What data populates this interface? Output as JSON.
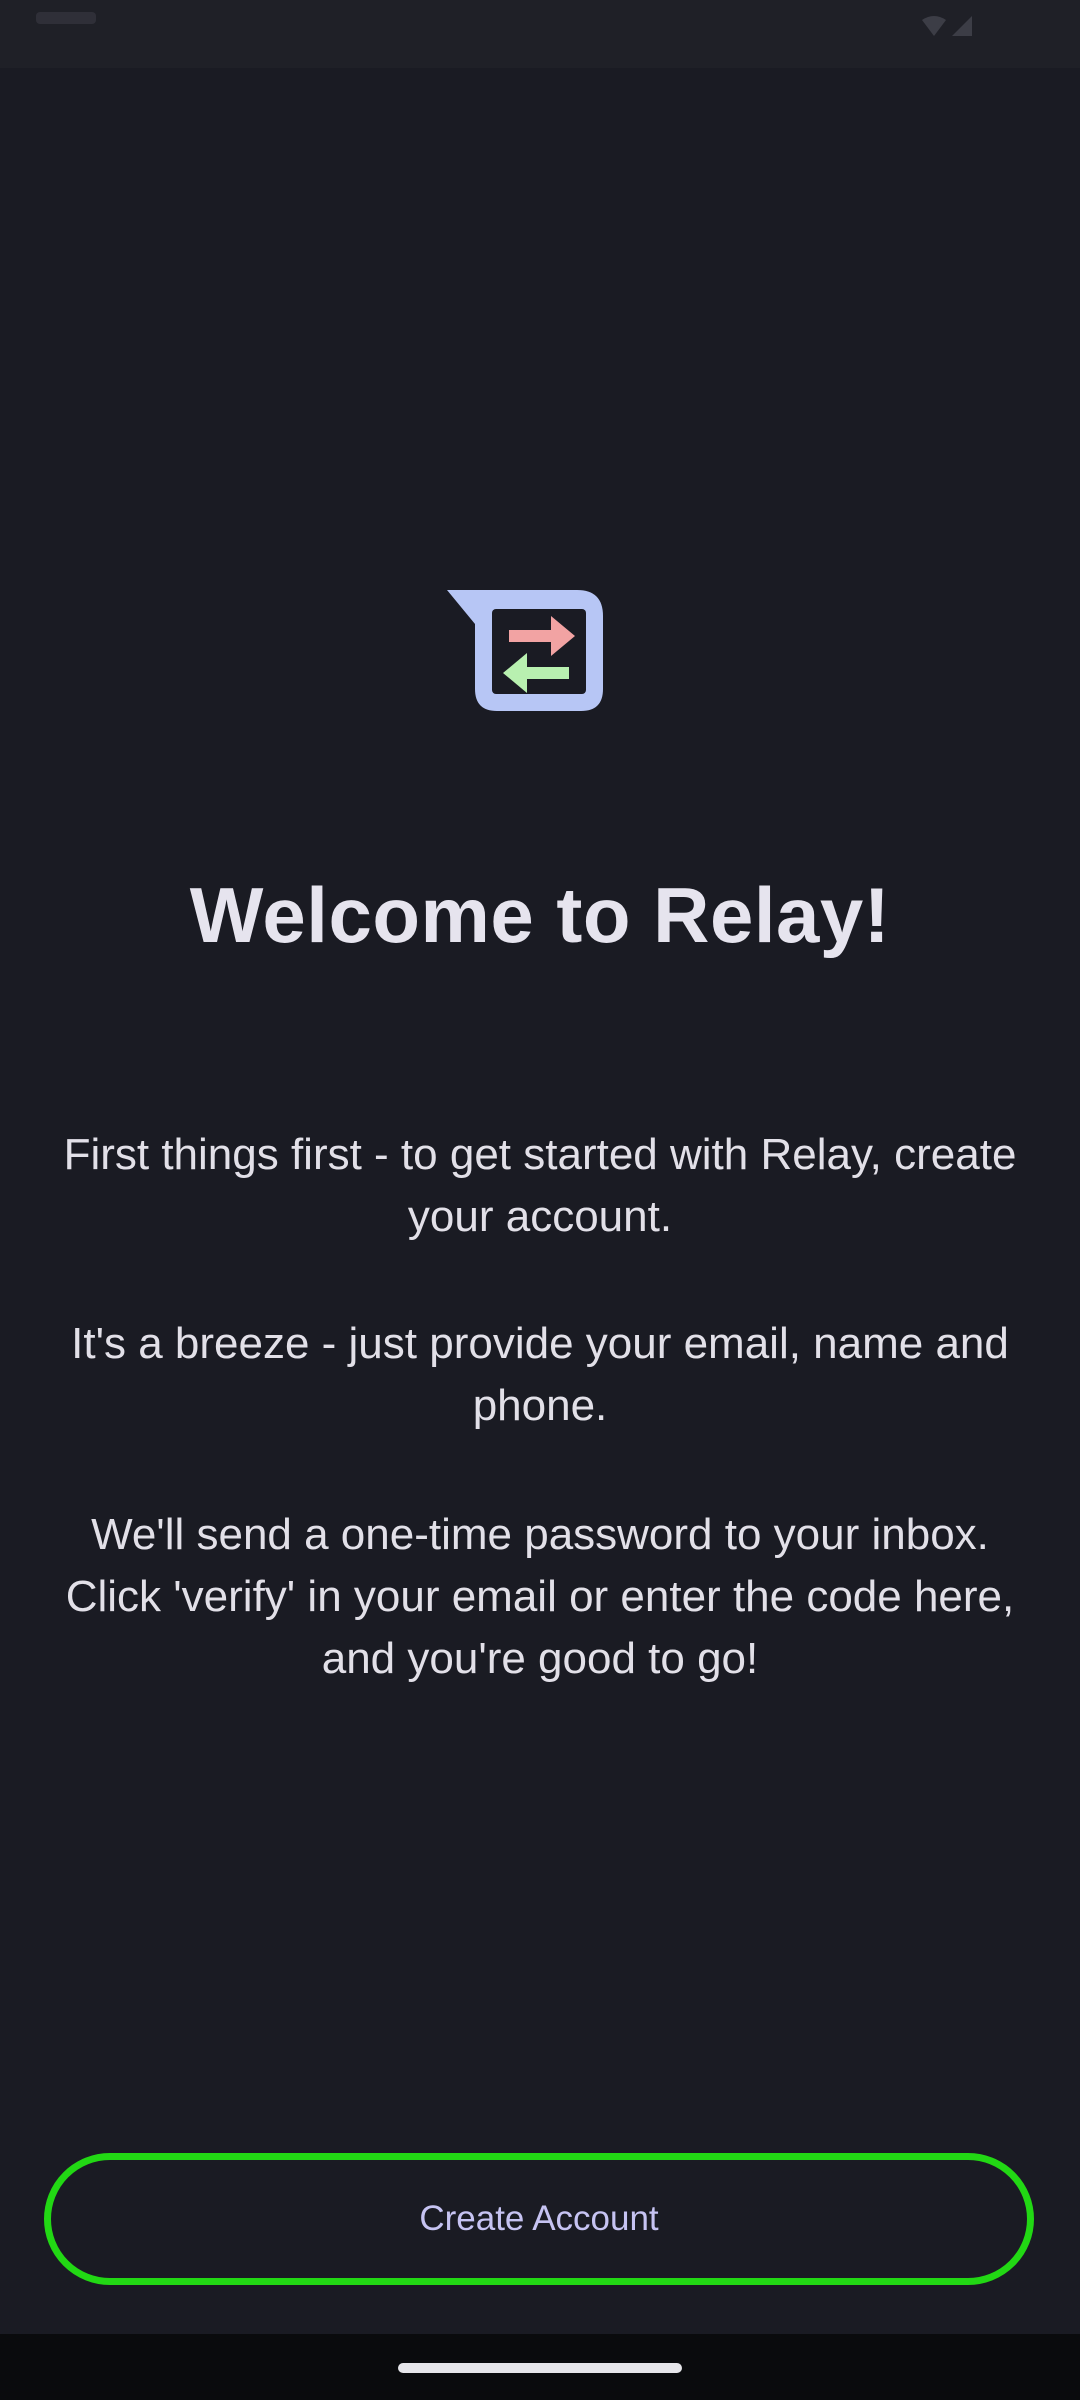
{
  "welcome": {
    "title": "Welcome to Relay!",
    "paragraphs": [
      "First things first - to get started with Relay, create your account.",
      "It's a breeze - just provide your email, name and phone.",
      "We'll send a one-time password to your inbox. Click 'verify' in your email or enter the code here, and you're good to go!"
    ]
  },
  "actions": {
    "create_account_label": "Create Account"
  },
  "icons": {
    "logo": "relay-logo-icon",
    "status_wifi": "wifi-icon",
    "status_signal": "signal-icon"
  },
  "colors": {
    "background": "#1a1b23",
    "button_border": "#22d814",
    "button_text": "#c6c3f2",
    "logo_frame": "#b7c6f5",
    "logo_arrow_right": "#f2a3a3",
    "logo_arrow_left": "#b8f0b0"
  }
}
